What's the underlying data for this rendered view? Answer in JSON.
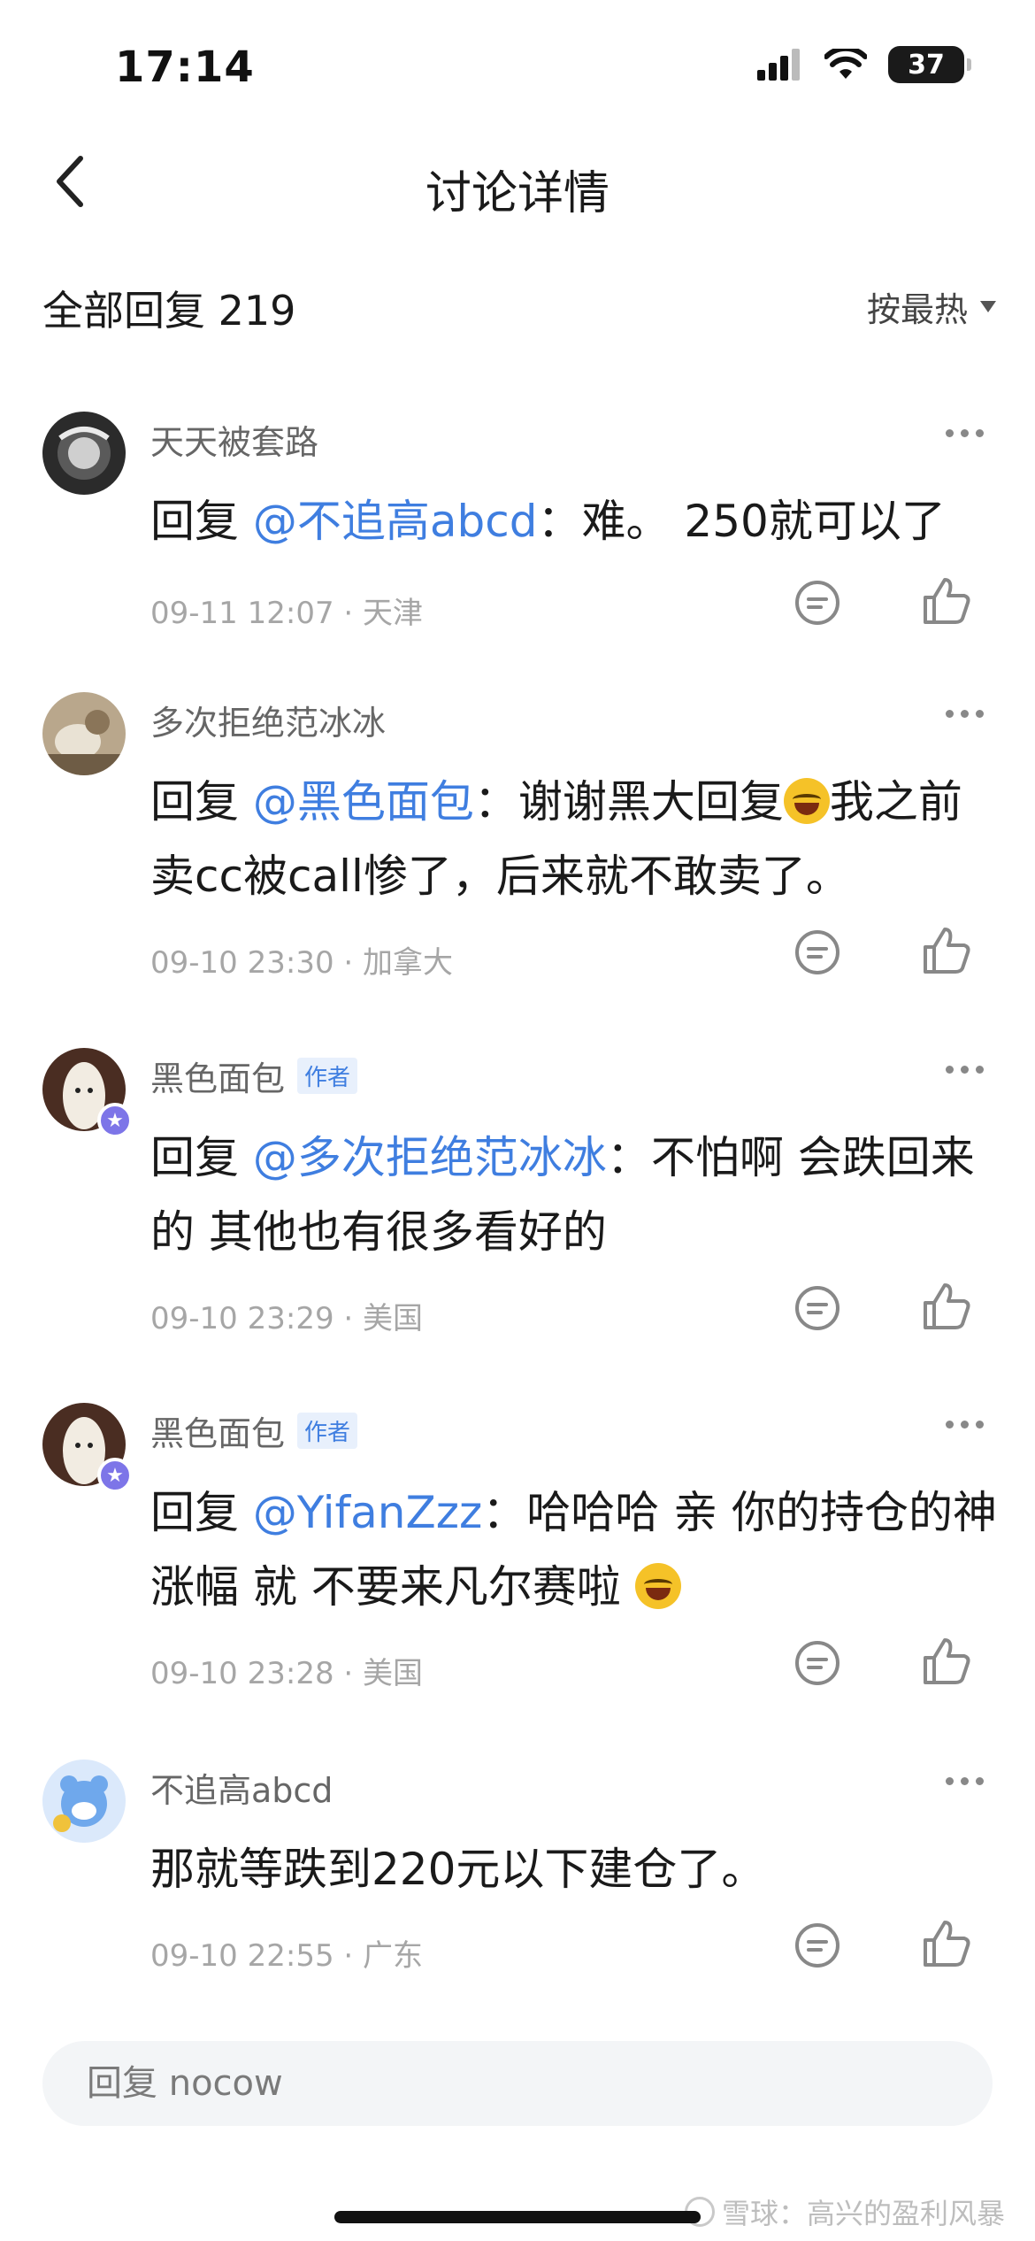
{
  "status_bar": {
    "time": "17:14",
    "battery": "37"
  },
  "nav": {
    "title": "讨论详情"
  },
  "section": {
    "title": "全部回复 219",
    "sort_label": "按最热"
  },
  "comments": [
    {
      "username": "天天被套路",
      "author_tag": "",
      "reply_prefix": "回复 ",
      "mention": "@不追高abcd",
      "text": "：难。 250就可以了",
      "date": "09-11 12:07",
      "location": "天津"
    },
    {
      "username": "多次拒绝范冰冰",
      "author_tag": "",
      "reply_prefix": "回复 ",
      "mention": "@黑色面包",
      "text_before_emoji": "：谢谢黑大回复",
      "emoji": "laughing-tears-emoji",
      "text_after_emoji": "我之前卖cc被call惨了，后来就不敢卖了。",
      "date": "09-10 23:30",
      "location": "加拿大"
    },
    {
      "username": "黑色面包",
      "author_tag": "作者",
      "reply_prefix": "回复 ",
      "mention": "@多次拒绝范冰冰",
      "text": "：不怕啊 会跌回来的 其他也有很多看好的",
      "date": "09-10 23:29",
      "location": "美国"
    },
    {
      "username": "黑色面包",
      "author_tag": "作者",
      "reply_prefix": "回复 ",
      "mention": "@YifanZzz",
      "text": "：哈哈哈 亲 你的持仓的神涨幅 就 不要来凡尔赛啦 ",
      "emoji": "laughing-tears-emoji",
      "date": "09-10 23:28",
      "location": "美国"
    },
    {
      "username": "不追高abcd",
      "author_tag": "",
      "text": "那就等跌到220元以下建仓了。",
      "date": "09-10 22:55",
      "location": "广东"
    }
  ],
  "meta_separator": " · ",
  "reply_bar": {
    "placeholder": "回复 nocow"
  },
  "watermark": "雪球：高兴的盈利风暴",
  "colors": {
    "mention": "#3f7ee0",
    "meta": "#a6a6a6",
    "author_tag_bg": "#e8f0fc",
    "badge": "#7d75e8"
  }
}
